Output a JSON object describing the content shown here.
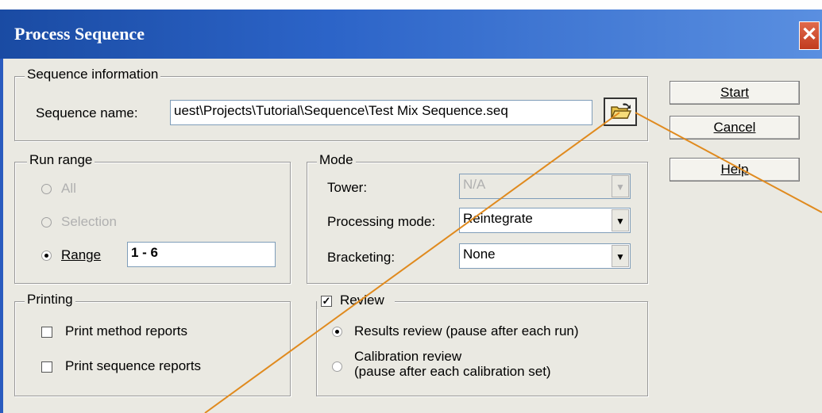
{
  "window": {
    "title": "Process Sequence",
    "close": "✕"
  },
  "sequence_info": {
    "legend": "Sequence information",
    "label": "Sequence name:",
    "value": "uest\\Projects\\Tutorial\\Sequence\\Test Mix Sequence.seq",
    "browse_icon": "folder-open-icon"
  },
  "buttons": {
    "start": "Start",
    "cancel": "Cancel",
    "help": "Help"
  },
  "run_range": {
    "legend": "Run range",
    "all": "All",
    "selection": "Selection",
    "range": "Range",
    "range_value": "1 - 6",
    "selected": "range"
  },
  "mode": {
    "legend": "Mode",
    "tower_label": "Tower:",
    "tower_value": "N/A",
    "processing_label": "Processing mode:",
    "processing_value": "Reintegrate",
    "bracketing_label": "Bracketing:",
    "bracketing_value": "None"
  },
  "printing": {
    "legend": "Printing",
    "method_reports": "Print method reports",
    "sequence_reports": "Print sequence reports"
  },
  "review": {
    "legend": "Review",
    "checked": true,
    "results": "Results review (pause after each run)",
    "calibration_line1": "Calibration review",
    "calibration_line2": "(pause after each calibration set)",
    "selected": "results"
  },
  "annotation_color": "#e08a1e"
}
